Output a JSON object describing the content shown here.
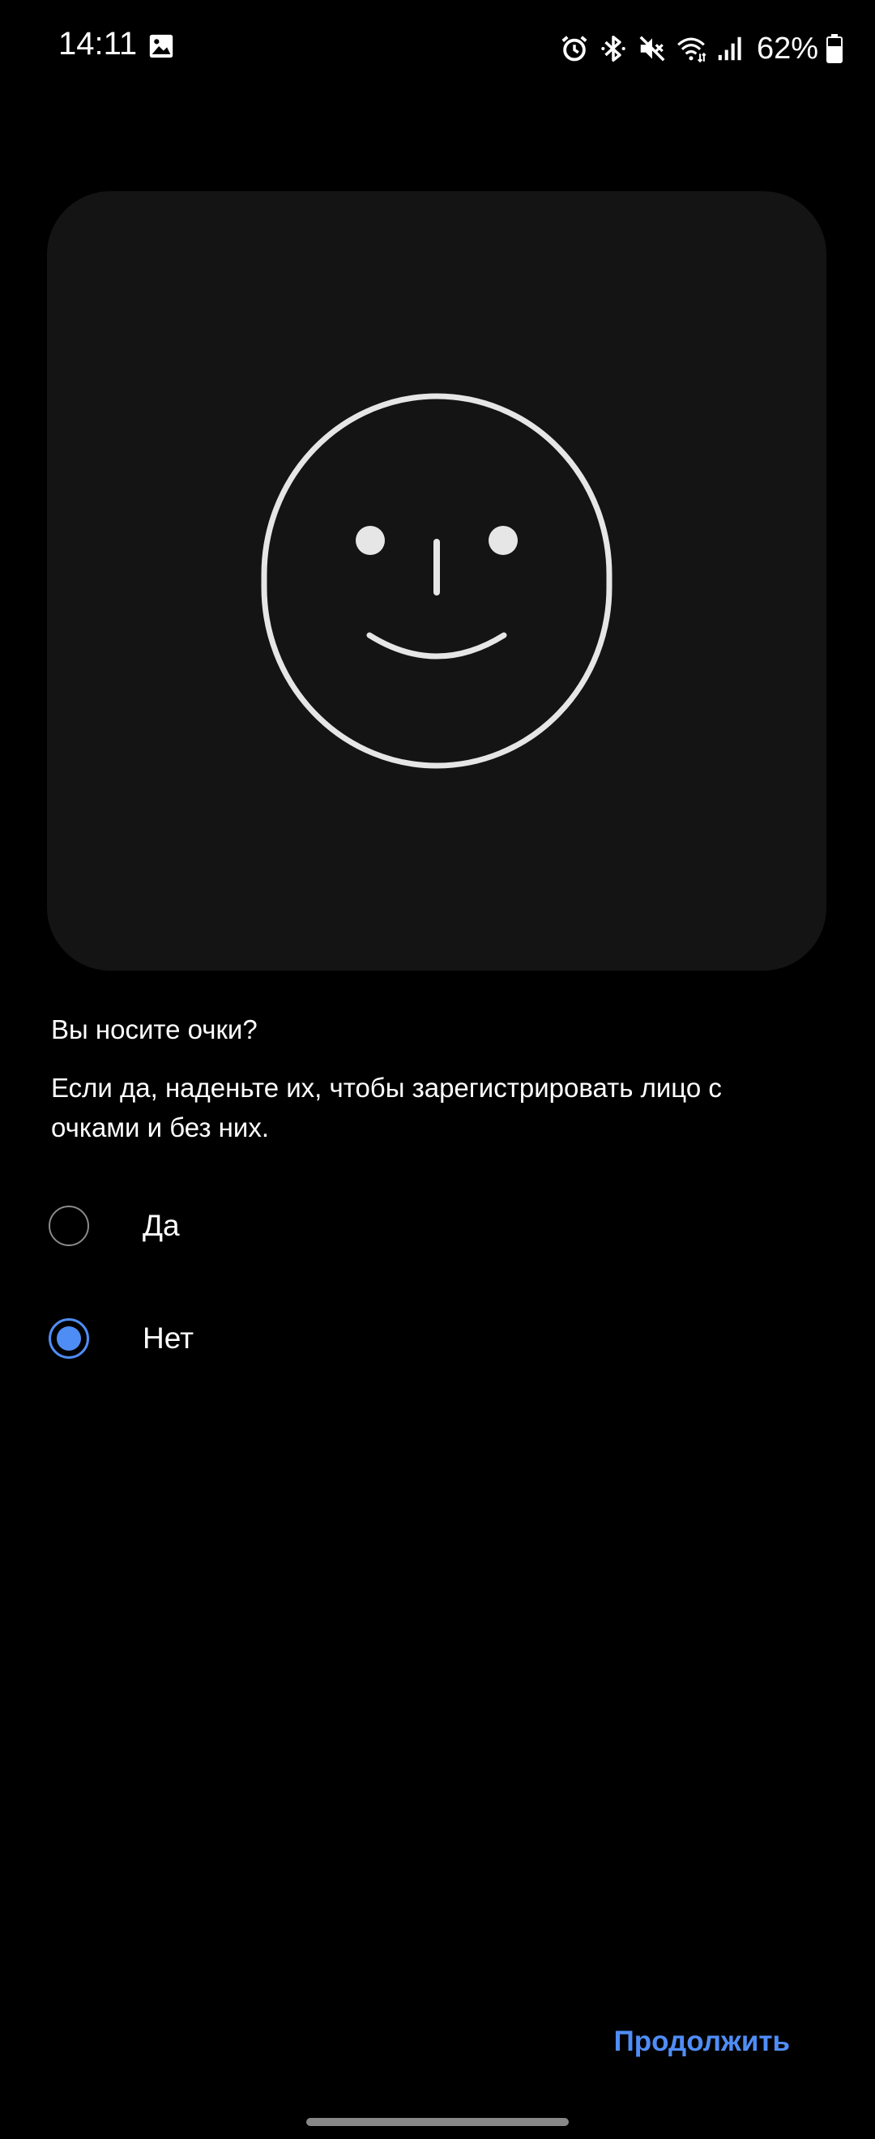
{
  "status_bar": {
    "time": "14:11",
    "battery_percent": "62%",
    "icons": [
      "gallery-icon",
      "alarm-icon",
      "bluetooth-icon",
      "mute-icon",
      "wifi-icon",
      "signal-icon",
      "battery-icon"
    ]
  },
  "illustration": {
    "icon": "face-icon"
  },
  "question": {
    "title": "Вы носите очки?",
    "hint": "Если да, наденьте их, чтобы зарегистрировать лицо с очками и без них."
  },
  "options": [
    {
      "label": "Да",
      "selected": false
    },
    {
      "label": "Нет",
      "selected": true
    }
  ],
  "footer": {
    "continue_label": "Продолжить"
  },
  "colors": {
    "accent": "#4f8df6",
    "background": "#000000",
    "card": "#141414",
    "face_stroke": "#e6e6e6"
  }
}
